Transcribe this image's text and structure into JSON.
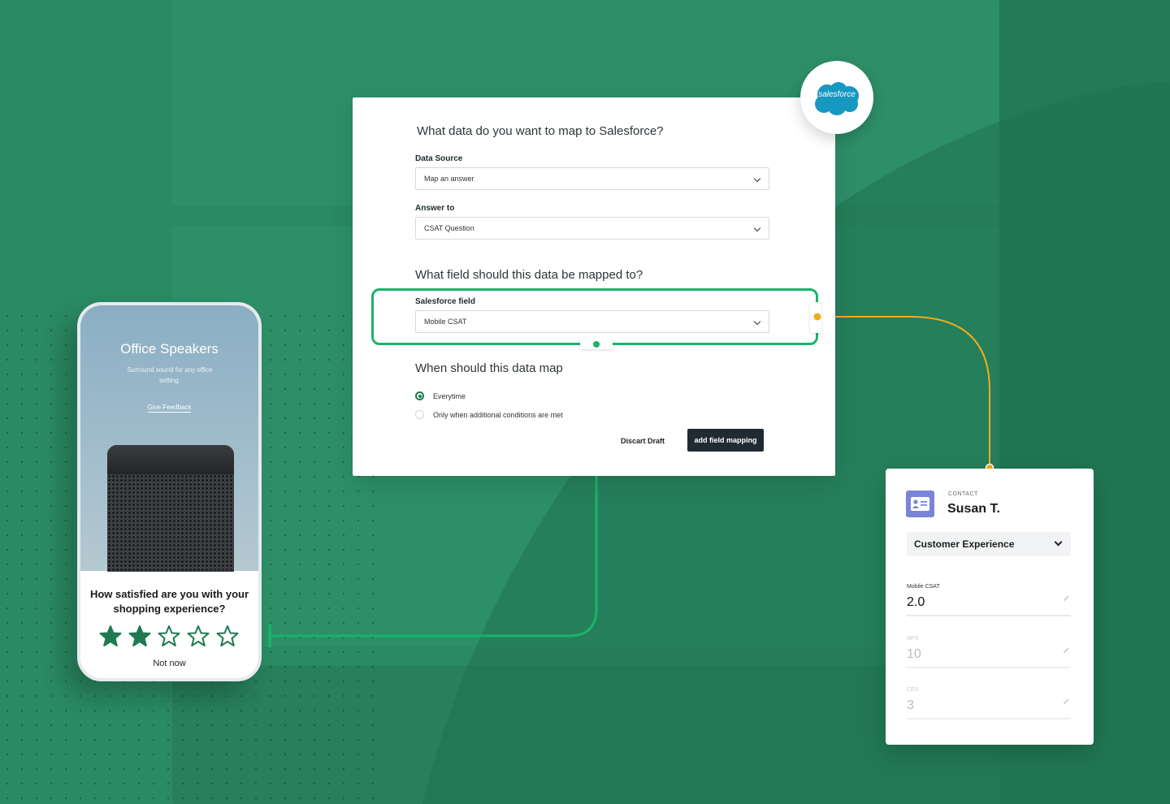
{
  "form": {
    "question_1": "What data do you want to map to Salesforce?",
    "data_source_label": "Data Source",
    "data_source_value": "Map an answer",
    "answer_to_label": "Answer to",
    "answer_to_value": "CSAT Question",
    "question_2": "What field should this data be mapped to?",
    "salesforce_field_label": "Salesforce field",
    "salesforce_field_value": "Mobile CSAT",
    "question_3": "When should this data map",
    "radio_options": [
      {
        "label": "Everytime",
        "selected": true
      },
      {
        "label": "Only when additional conditions are met",
        "selected": false
      }
    ],
    "discard_label": "Discart Draft",
    "add_label": "add field mapping"
  },
  "salesforce_logo_text": "salesforce",
  "phone": {
    "title": "Office Speakers",
    "subtitle": "Surround sound for any office setting.",
    "link": "Give Feedback",
    "question": "How satisfied are you with your shopping experience?",
    "rating": {
      "filled": 2,
      "total": 5
    },
    "dismiss": "Not now"
  },
  "contact": {
    "kicker": "CONTACT",
    "name": "Susan T.",
    "section": "Customer Experience",
    "fields": [
      {
        "label": "Mobile CSAT",
        "value": "2.0"
      },
      {
        "label": "NPS",
        "value": "10"
      },
      {
        "label": "CES",
        "value": "3"
      }
    ]
  },
  "colors": {
    "background": "#2a8a63",
    "accent_green": "#1ab36a",
    "connector_orange": "#f0ac1b",
    "star_green": "#1f7a52",
    "salesforce_blue": "#1798c1",
    "contact_icon": "#7a85d8",
    "button_dark": "#1f2a33"
  },
  "icons": [
    "chevron-down-icon",
    "star-icon",
    "contact-card-icon",
    "pencil-icon",
    "salesforce-cloud-icon"
  ]
}
